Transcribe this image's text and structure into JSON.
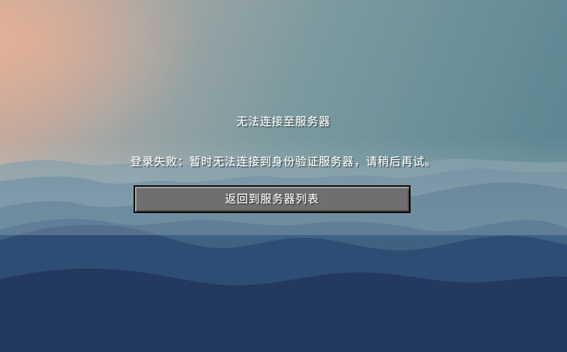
{
  "screen": {
    "title": "无法连接至服务器",
    "message": "登录失败：暂时无法连接到身份验证服务器，请稍后再试。"
  },
  "buttons": {
    "back_to_server_list": "返回到服务器列表"
  },
  "colors": {
    "sky_warm": "#d7ab96",
    "sky_mid": "#8aa0a7",
    "sky_cool": "#5f8892",
    "mountain_far": "#5f8296",
    "mountain_mid": "#3c5f80",
    "mountain_near": "#223b62",
    "button_face": "#6f6f6f",
    "text": "#ffffff"
  }
}
